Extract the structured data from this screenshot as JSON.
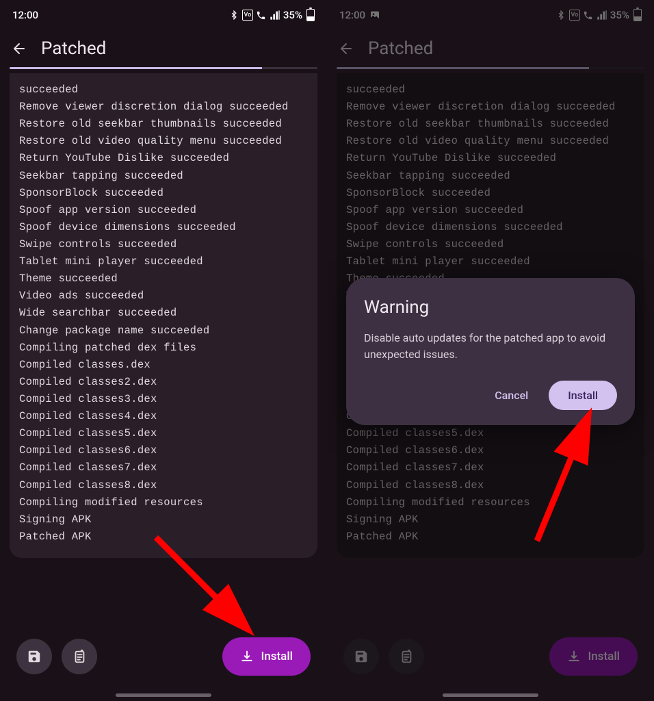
{
  "status": {
    "time": "12:00",
    "battery_text": "35%",
    "has_picture_icon": [
      false,
      true
    ]
  },
  "app": {
    "title": "Patched"
  },
  "log_lines": [
    "succeeded",
    "Remove viewer discretion dialog succeeded",
    "Restore old seekbar thumbnails succeeded",
    "Restore old video quality menu succeeded",
    "Return YouTube Dislike succeeded",
    "Seekbar tapping succeeded",
    "SponsorBlock succeeded",
    "Spoof app version succeeded",
    "Spoof device dimensions succeeded",
    "Swipe controls succeeded",
    "Tablet mini player succeeded",
    "Theme succeeded",
    "Video ads succeeded",
    "Wide searchbar succeeded",
    "Change package name succeeded",
    "Compiling patched dex files",
    "Compiled classes.dex",
    "Compiled classes2.dex",
    "Compiled classes3.dex",
    "Compiled classes4.dex",
    "Compiled classes5.dex",
    "Compiled classes6.dex",
    "Compiled classes7.dex",
    "Compiled classes8.dex",
    "Compiling modified resources",
    "Signing APK",
    "Patched APK"
  ],
  "buttons": {
    "install": "Install"
  },
  "dialog": {
    "title": "Warning",
    "body": "Disable auto updates for the patched app to avoid unexpected issues.",
    "cancel": "Cancel",
    "confirm": "Install"
  }
}
